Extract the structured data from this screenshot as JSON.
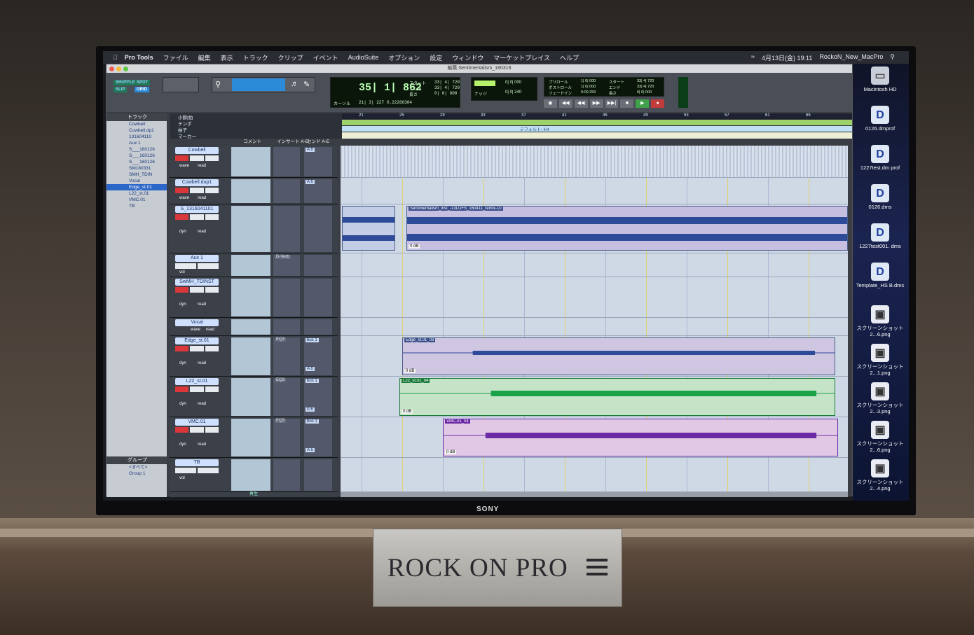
{
  "menu": {
    "items": [
      "Pro Tools",
      "ファイル",
      "編集",
      "表示",
      "トラック",
      "クリップ",
      "イベント",
      "AudioSuite",
      "オプション",
      "設定",
      "ウィンドウ",
      "マーケットプレイス",
      "ヘルプ"
    ],
    "datetime": "4月13日(金) 19:11",
    "user": "RockoN_New_MacPro"
  },
  "window": {
    "title": "編集:Sentimentalism_180316"
  },
  "toolbar": {
    "modes": [
      "SHUFFLE",
      "SPOT",
      "SLIP",
      "GRID"
    ],
    "counter_main": "35| 1| 862",
    "counter_label": "カーソル",
    "counter_sub": "21| 3| 227",
    "counter_sample": "0.22266304",
    "start_label": "スタート",
    "end_label": "エンド",
    "length_label": "長さ",
    "start_val": "33| 4| 720",
    "end_val": "33| 4| 720",
    "length_val": "0| 0| 000",
    "nudge_label": "ナッジ",
    "nudge_val": "0| 0| 240",
    "grid_val": "0| 0| 000",
    "preroll_label": "プリロール",
    "postroll_label": "ポストロール",
    "fadein_label": "フェードイン",
    "preroll_val": "1| 0| 000",
    "postroll_val": "1| 0| 000",
    "fadein_val": "0:00.250",
    "transport": [
      "◉",
      "◀◀",
      "◀◀",
      "▶▶",
      "▶▶|",
      "■",
      "▶",
      "●"
    ]
  },
  "tracklist": {
    "header": "トラック",
    "items": [
      "Cowbell",
      "Cowbell.dp1",
      "131604110",
      "Aux 1",
      "S___160126",
      "S___160126",
      "S___160126",
      "SM180331",
      "SMH_TDIN",
      "Vocal",
      "Edge_st.01",
      "L22_st.01",
      "VMC.01",
      "TB"
    ]
  },
  "grouplist": {
    "header": "グループ",
    "items": [
      "<すべて>",
      "Group 1"
    ]
  },
  "rulers": {
    "bars_label": "小節|拍",
    "tempo_label": "テンポ",
    "meter_label": "拍子",
    "marker_label": "マーカー",
    "meter_value": "デフォルト: 4/4",
    "bar_numbers": [
      "21",
      "25",
      "29",
      "33",
      "37",
      "41",
      "45",
      "49",
      "53",
      "57",
      "61",
      "65"
    ]
  },
  "columns": {
    "comment": "コメント",
    "inserts": "インサート A-E",
    "sends": "センド A-E"
  },
  "tracks": [
    {
      "name": "Cowbell",
      "mode": "wave",
      "auto": "read",
      "send": "A 6"
    },
    {
      "name": "Cowbell.dup1",
      "mode": "wave",
      "auto": "read",
      "send": "A 6"
    },
    {
      "name": "S_1316041101",
      "mode": "dyn",
      "auto": "read"
    },
    {
      "name": "Aux 1",
      "mode": "vol",
      "insert": "D-Verb"
    },
    {
      "name": "SwMH_TDINST",
      "mode": "dyn",
      "auto": "read"
    },
    {
      "name": "Vocal",
      "mode": "wave",
      "auto": "read"
    },
    {
      "name": "Edge_st.01",
      "mode": "dyn",
      "auto": "read",
      "insert": "EQ3",
      "send": "bus 1",
      "send2": "A 6"
    },
    {
      "name": "L22_st.01",
      "mode": "dyn",
      "auto": "read",
      "insert": "EQ3",
      "send": "bus 1",
      "send2": "A 6"
    },
    {
      "name": "VMC.01",
      "mode": "dyn",
      "auto": "read",
      "insert": "EQ3",
      "send": "bus 1",
      "send2": "A 6"
    },
    {
      "name": "TB",
      "mode": "vol"
    }
  ],
  "clips": {
    "main": "Sentimentalism_inst_-13LUFS_160411_remix-10",
    "edge": "Edge_st.01_03",
    "l22": "L22_st.01_04",
    "vmc": "VMC.01_04",
    "gain": "0 dB"
  },
  "footer": {
    "label": "再生"
  },
  "desktop": {
    "items": [
      "Macintosh HD",
      "0126.dmprof",
      "1227test.dm prof",
      "0126.dms",
      "1227test001. dms",
      "Template_HS B.dms",
      "スクリーンショット 2...6.png",
      "スクリーンショット 2...1.png",
      "スクリーンショット 2...3.png",
      "スクリーンショット 2...6.png",
      "スクリーンショット 2...4.png"
    ]
  },
  "tv": {
    "brand": "SONY"
  },
  "sign": {
    "text": "ROCK ON PRO"
  },
  "colors": {
    "waveform_blue": "#2e4b9a",
    "waveform_green": "#1ba34a",
    "waveform_purple": "#6b2aa6",
    "tempo_green": "#9dd26a",
    "record_red": "#d9373a"
  }
}
